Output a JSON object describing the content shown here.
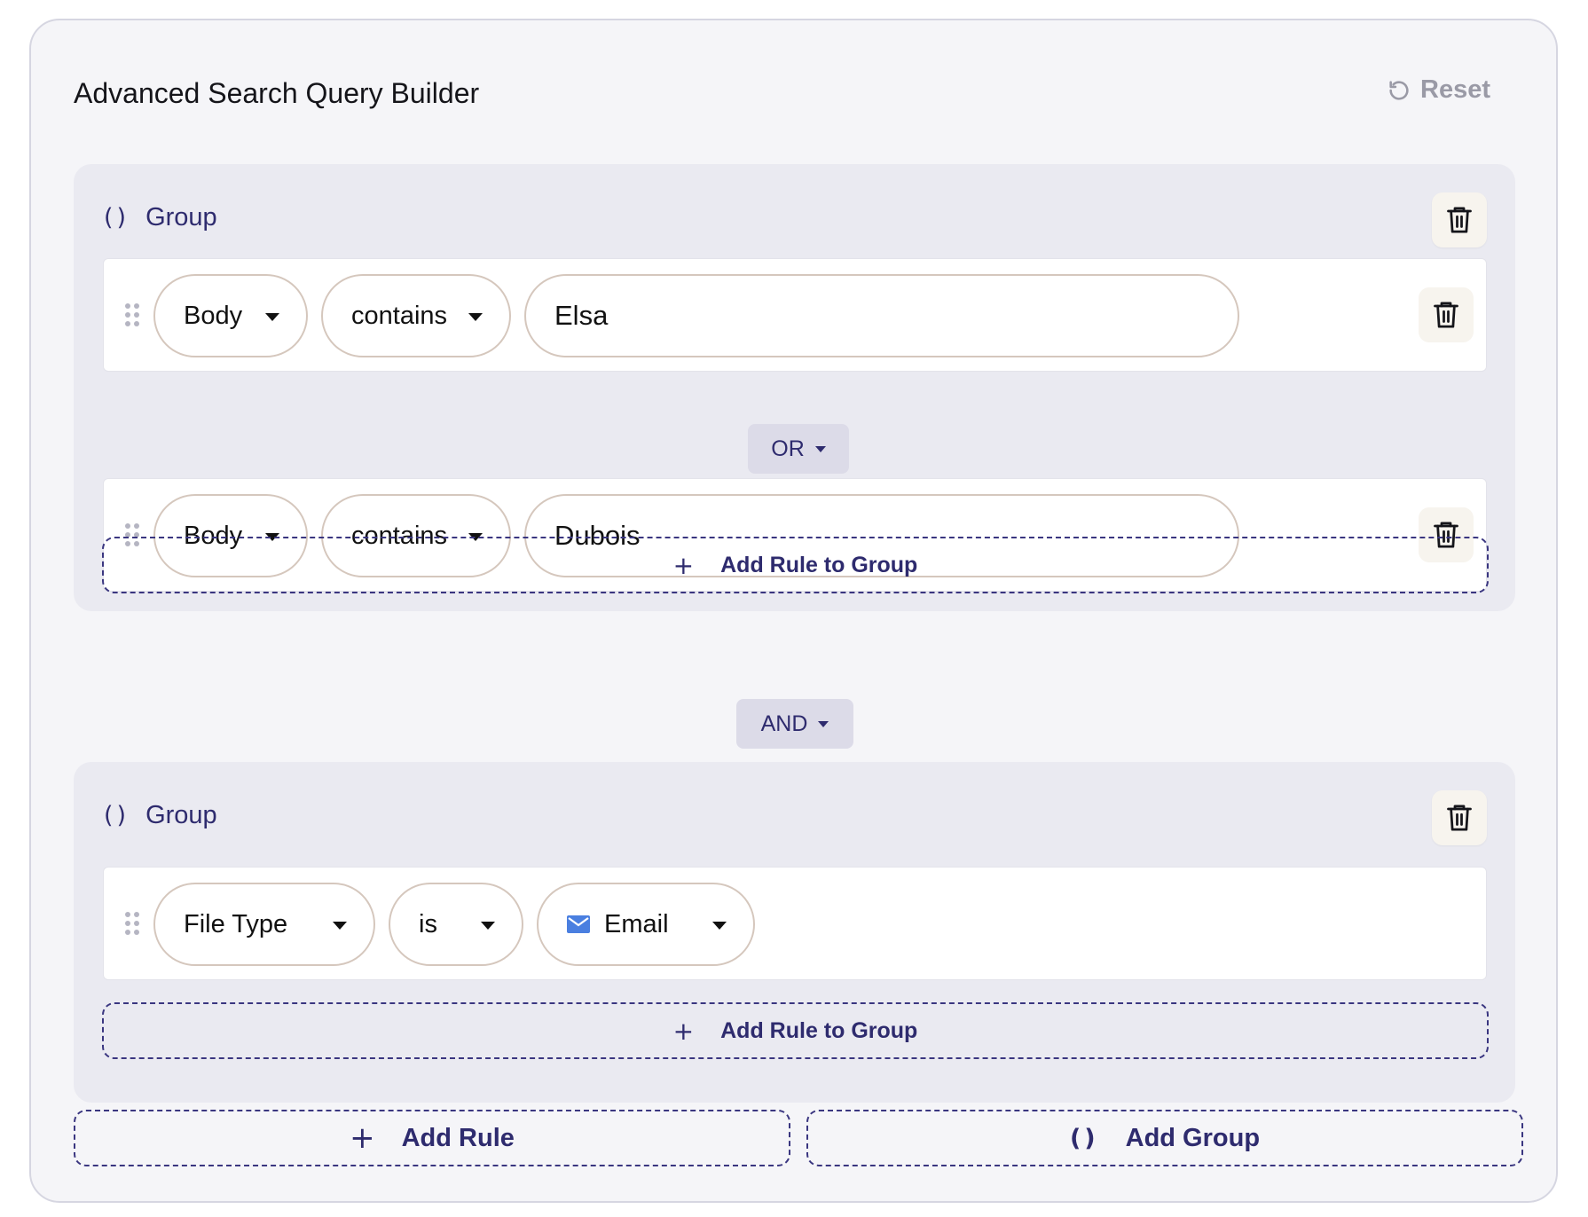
{
  "header": {
    "title": "Advanced Search Query Builder",
    "reset_label": "Reset"
  },
  "groups": [
    {
      "label": "Group",
      "paren_icon": "()",
      "rules": [
        {
          "field": "Body",
          "operator": "contains",
          "value": "Elsa"
        },
        {
          "field": "Body",
          "operator": "contains",
          "value": "Dubois"
        }
      ],
      "combinator": "OR",
      "add_rule_label": "Add Rule to Group"
    },
    {
      "label": "Group",
      "paren_icon": "()",
      "rules": [
        {
          "field": "File Type",
          "operator": "is",
          "value": "Email",
          "value_icon": "email-icon"
        }
      ],
      "add_rule_label": "Add Rule to Group"
    }
  ],
  "root_combinator": "AND",
  "footer": {
    "add_rule_label": "Add Rule",
    "add_group_label": "Add Group",
    "plus_icon": "+",
    "paren_icon": "()"
  },
  "colors": {
    "accent": "#2e2b6e",
    "pill_border": "#d5c7bd",
    "group_bg": "#eaeaf1",
    "email_icon": "#4a7fe0"
  }
}
